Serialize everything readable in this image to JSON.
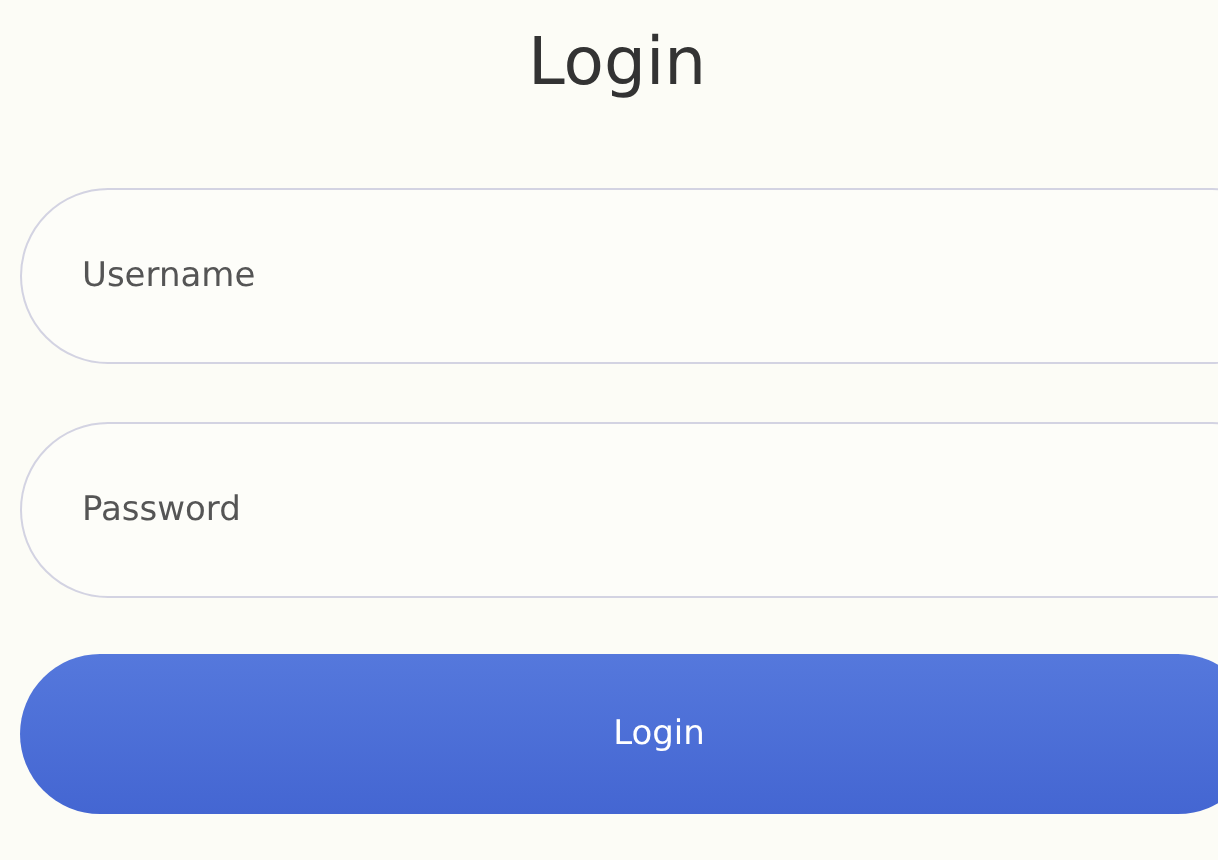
{
  "title": "Login",
  "fields": [
    {
      "placeholder": "Username"
    },
    {
      "placeholder": "Password"
    }
  ],
  "button": {
    "label": "Login"
  }
}
